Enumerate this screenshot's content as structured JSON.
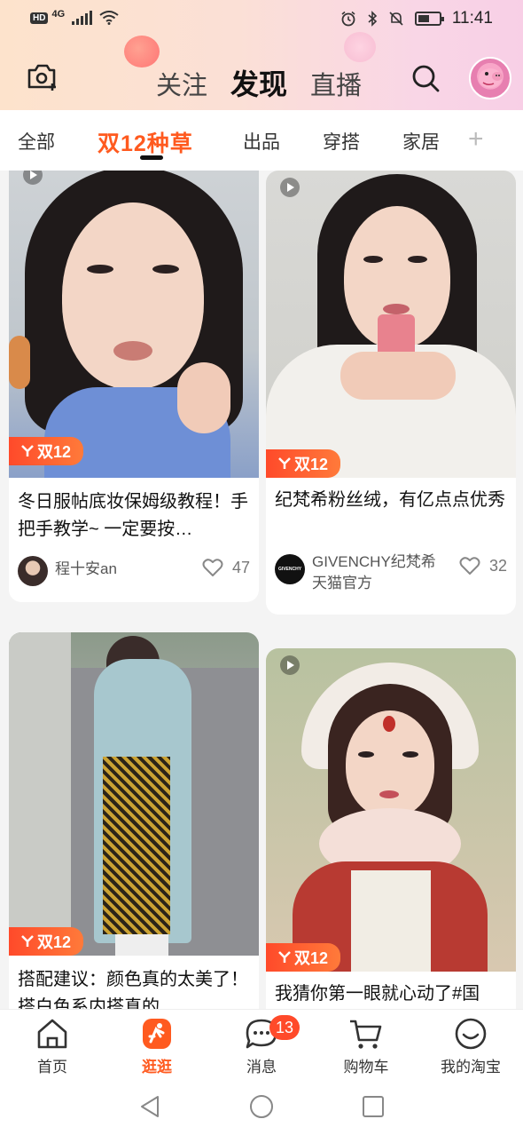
{
  "status_bar": {
    "hd": "HD",
    "network": "4G",
    "time": "11:41"
  },
  "header": {
    "tabs": [
      {
        "label": "关注"
      },
      {
        "label": "发现"
      },
      {
        "label": "直播"
      }
    ]
  },
  "categories": {
    "items": [
      "全部",
      "双12种草",
      "出品",
      "穿搭",
      "家居"
    ],
    "add": "+"
  },
  "feed": {
    "tag_label": "双12",
    "cards": [
      {
        "title": "冬日服帖底妆保姆级教程！手把手教学~ 一定要按…",
        "author": "程十安an",
        "likes": "47"
      },
      {
        "title": "纪梵希粉丝绒，有亿点点优秀",
        "author": "GIVENCHY纪梵希天猫官方",
        "author_line1": "GIVENCHY纪梵希",
        "author_line2": "天猫官方",
        "likes": "32",
        "avatar_text": "GIVENCHY"
      },
      {
        "title": "搭配建议：颜色真的太美了！搭白色系内搭真的",
        "title_visible": "搭配建议：颜色真的太美了！搭白色系内搭真的"
      },
      {
        "title": "我猜你第一眼就心动了#国"
      }
    ]
  },
  "bottom_nav": {
    "items": [
      {
        "label": "首页"
      },
      {
        "label": "逛逛"
      },
      {
        "label": "消息",
        "badge": "13"
      },
      {
        "label": "购物车"
      },
      {
        "label": "我的淘宝"
      }
    ]
  },
  "colors": {
    "accent": "#ff5a1f",
    "badge": "#ff4a2a"
  }
}
